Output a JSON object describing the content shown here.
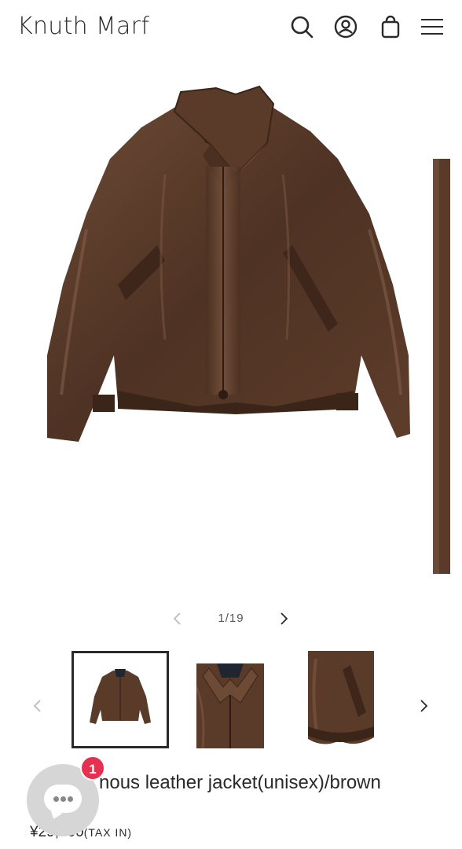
{
  "header": {
    "logo": "Knuth Marf",
    "icons": [
      "search-icon",
      "account-icon",
      "cart-icon",
      "menu-icon"
    ]
  },
  "gallery": {
    "counter": "1/19",
    "prev_icon": "chevron-left-icon",
    "next_icon": "chevron-right-icon"
  },
  "product": {
    "title": "nous leather jacket(unisex)/brown",
    "price": "¥29,700",
    "tax": "(TAX IN)"
  },
  "chat": {
    "badge": "1"
  },
  "colors": {
    "leather": "#5a3a28",
    "badge": "#e53050"
  }
}
